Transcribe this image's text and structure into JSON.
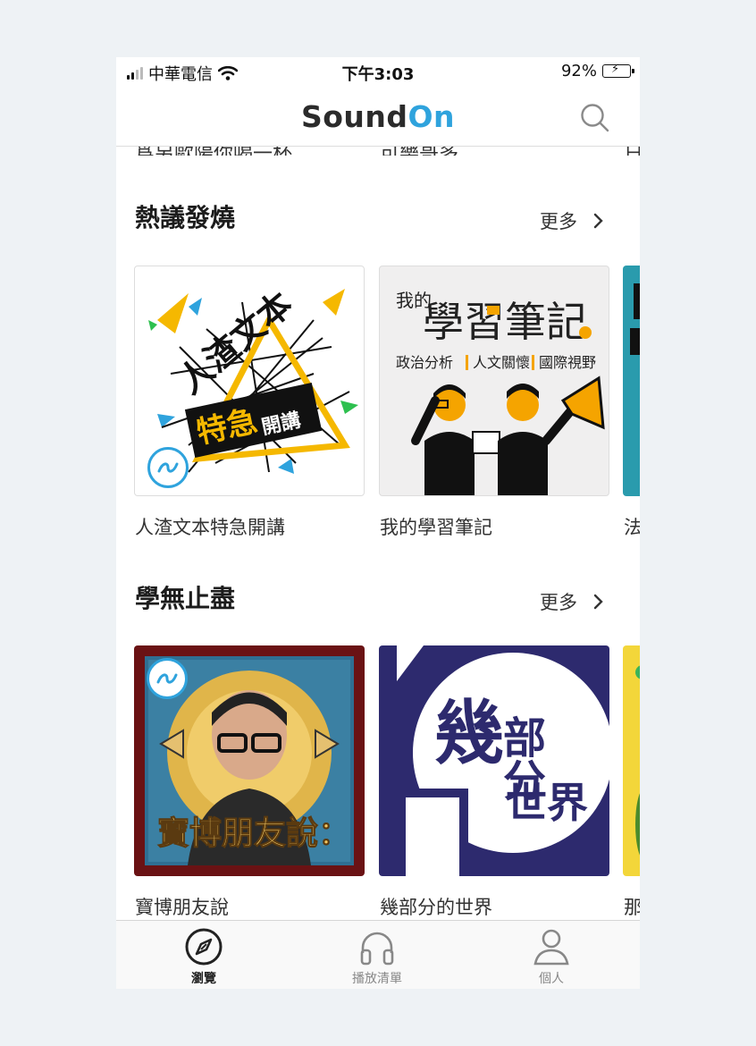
{
  "status_bar": {
    "carrier": "中華電信",
    "time": "下午3:03",
    "battery_text": "92%",
    "battery_level": 0.92
  },
  "header": {
    "logo_part1": "Sound",
    "logo_part2": "On",
    "brand_color": "#2fa3dd"
  },
  "partial_row": {
    "labels": [
      "爲另歐陽你喝一杯",
      "可樂哥多",
      "日"
    ]
  },
  "sections": [
    {
      "title": "熱議發燒",
      "more_label": "更多",
      "cards": [
        {
          "label": "人渣文本特急開講",
          "art_text_1": "人渣文本",
          "art_text_2": "特急",
          "art_text_3": "開講"
        },
        {
          "label": "我的學習筆記",
          "art_small": "我的",
          "art_big": "學習筆記",
          "art_tags": [
            "政治分析",
            "人文關懷",
            "國際視野"
          ]
        },
        {
          "label": "法"
        }
      ]
    },
    {
      "title": "學無止盡",
      "more_label": "更多",
      "cards": [
        {
          "label": "寶博朋友說",
          "art_text": "寶博朋友說："
        },
        {
          "label": "幾部分的世界",
          "art_big": "幾",
          "art_right": "部分",
          "art_bottom_small": "的",
          "art_bottom": "世界"
        },
        {
          "label": "那"
        }
      ]
    }
  ],
  "tabbar": {
    "items": [
      {
        "label": "瀏覽",
        "icon": "compass-icon",
        "active": true
      },
      {
        "label": "播放清單",
        "icon": "headphones-icon",
        "active": false
      },
      {
        "label": "個人",
        "icon": "person-icon",
        "active": false
      }
    ]
  }
}
